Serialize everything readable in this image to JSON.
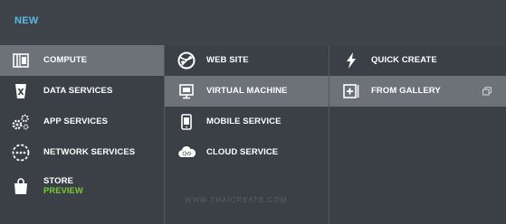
{
  "header": {
    "title": "NEW"
  },
  "columns": {
    "categories": [
      {
        "label": "COMPUTE",
        "icon": "compute-icon",
        "selected": true
      },
      {
        "label": "DATA SERVICES",
        "icon": "data-services-icon",
        "selected": false
      },
      {
        "label": "APP SERVICES",
        "icon": "app-services-gears-icon",
        "selected": false
      },
      {
        "label": "NETWORK SERVICES",
        "icon": "network-services-icon",
        "selected": false
      },
      {
        "label": "STORE",
        "badge": "PREVIEW",
        "icon": "shopping-bag-icon",
        "selected": false
      }
    ],
    "compute_items": [
      {
        "label": "WEB SITE",
        "icon": "web-site-icon",
        "selected": false
      },
      {
        "label": "VIRTUAL MACHINE",
        "icon": "virtual-machine-icon",
        "selected": true
      },
      {
        "label": "MOBILE SERVICE",
        "icon": "mobile-service-icon",
        "selected": false
      },
      {
        "label": "CLOUD SERVICE",
        "icon": "cloud-service-icon",
        "selected": false
      }
    ],
    "create_options": [
      {
        "label": "QUICK CREATE",
        "icon": "lightning-icon",
        "selected": false
      },
      {
        "label": "FROM GALLERY",
        "icon": "plus-box-icon",
        "selected": true,
        "trailing_icon": "restore-window-icon"
      }
    ]
  },
  "watermark": "WWW.THAICREATE.COM",
  "colors": {
    "background": "#3b3f46",
    "selected": "#6d7278",
    "accent_blue": "#5cb8e6",
    "accent_green": "#78c83a"
  }
}
